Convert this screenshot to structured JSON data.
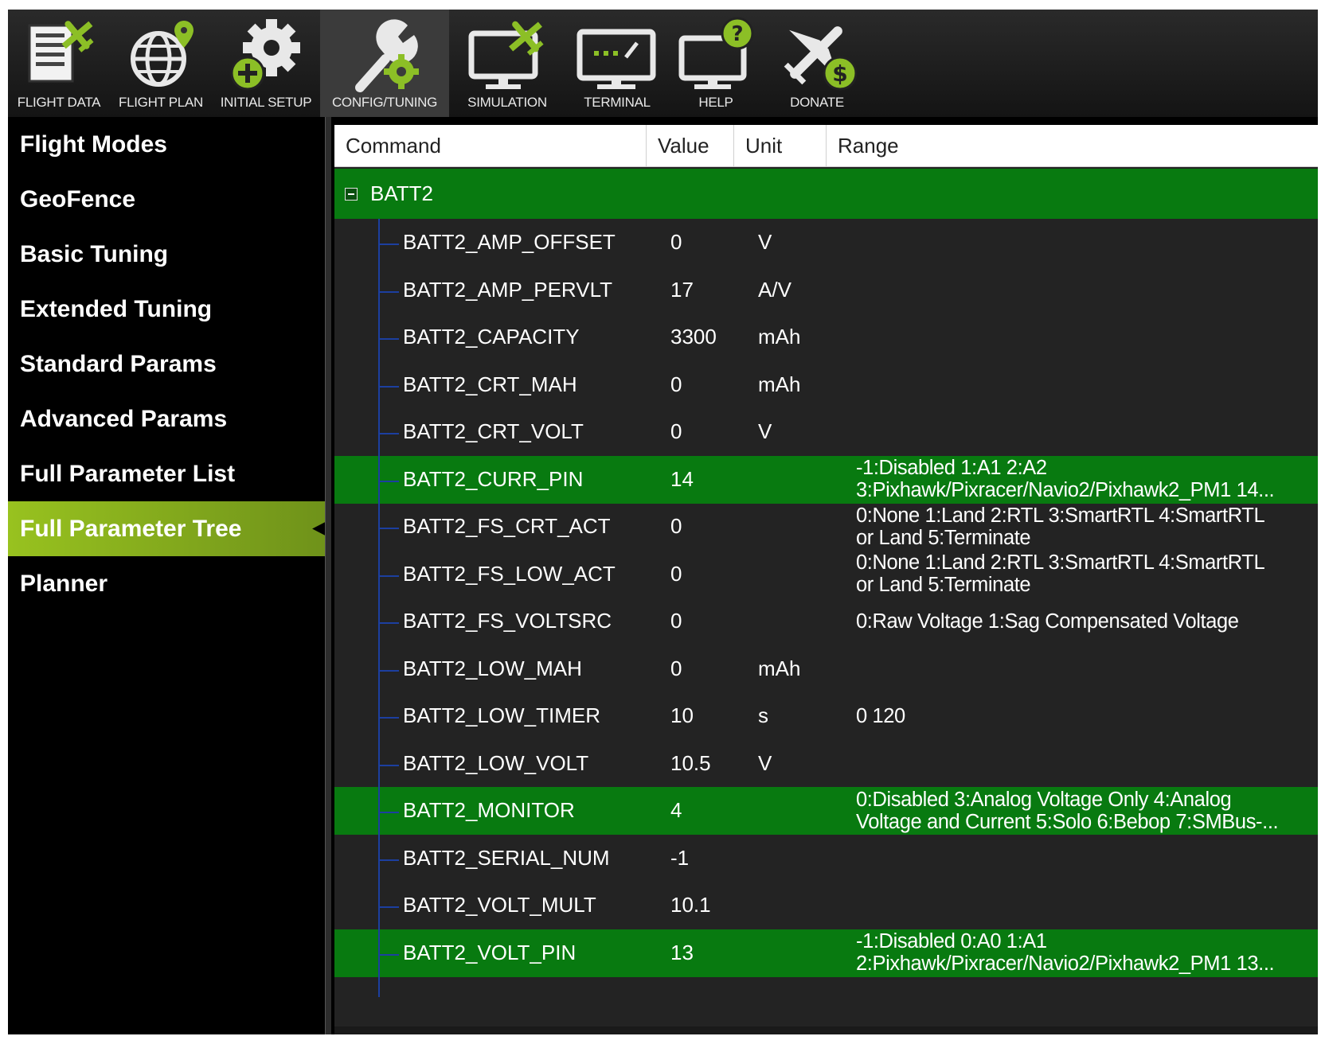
{
  "toolbar": {
    "items": [
      {
        "label": "FLIGHT DATA",
        "icon": "flight-data-icon"
      },
      {
        "label": "FLIGHT PLAN",
        "icon": "flight-plan-icon"
      },
      {
        "label": "INITIAL SETUP",
        "icon": "initial-setup-icon"
      },
      {
        "label": "CONFIG/TUNING",
        "icon": "config-tuning-icon",
        "active": true
      },
      {
        "label": "SIMULATION",
        "icon": "simulation-icon"
      },
      {
        "label": "TERMINAL",
        "icon": "terminal-icon"
      },
      {
        "label": "HELP",
        "icon": "help-icon"
      },
      {
        "label": "DONATE",
        "icon": "donate-icon"
      }
    ]
  },
  "sidebar": {
    "items": [
      {
        "label": "Flight Modes"
      },
      {
        "label": "GeoFence"
      },
      {
        "label": "Basic Tuning"
      },
      {
        "label": "Extended Tuning"
      },
      {
        "label": "Standard Params"
      },
      {
        "label": "Advanced Params"
      },
      {
        "label": "Full Parameter List"
      },
      {
        "label": "Full Parameter Tree",
        "active": true
      },
      {
        "label": "Planner"
      }
    ]
  },
  "grid": {
    "columns": [
      "Command",
      "Value",
      "Unit",
      "Range"
    ],
    "group": "BATT2",
    "rows": [
      {
        "command": "BATT2_AMP_OFFSET",
        "value": "0",
        "unit": "V",
        "range": "",
        "highlight": false
      },
      {
        "command": "BATT2_AMP_PERVLT",
        "value": "17",
        "unit": "A/V",
        "range": "",
        "highlight": false
      },
      {
        "command": "BATT2_CAPACITY",
        "value": "3300",
        "unit": "mAh",
        "range": "",
        "highlight": false
      },
      {
        "command": "BATT2_CRT_MAH",
        "value": "0",
        "unit": "mAh",
        "range": "",
        "highlight": false
      },
      {
        "command": "BATT2_CRT_VOLT",
        "value": "0",
        "unit": "V",
        "range": "",
        "highlight": false
      },
      {
        "command": "BATT2_CURR_PIN",
        "value": "14",
        "unit": "",
        "range": "-1:Disabled  1:A1  2:A2\n3:Pixhawk/Pixracer/Navio2/Pixhawk2_PM1  14...",
        "highlight": true
      },
      {
        "command": "BATT2_FS_CRT_ACT",
        "value": "0",
        "unit": "",
        "range": "0:None 1:Land 2:RTL 3:SmartRTL 4:SmartRTL\nor Land 5:Terminate",
        "highlight": false
      },
      {
        "command": "BATT2_FS_LOW_ACT",
        "value": "0",
        "unit": "",
        "range": "0:None 1:Land 2:RTL 3:SmartRTL 4:SmartRTL\nor Land 5:Terminate",
        "highlight": false
      },
      {
        "command": "BATT2_FS_VOLTSRC",
        "value": "0",
        "unit": "",
        "range": "0:Raw Voltage  1:Sag Compensated Voltage",
        "highlight": false
      },
      {
        "command": "BATT2_LOW_MAH",
        "value": "0",
        "unit": "mAh",
        "range": "",
        "highlight": false
      },
      {
        "command": "BATT2_LOW_TIMER",
        "value": "10",
        "unit": "s",
        "range": "0 120",
        "highlight": false
      },
      {
        "command": "BATT2_LOW_VOLT",
        "value": "10.5",
        "unit": "V",
        "range": "",
        "highlight": false
      },
      {
        "command": "BATT2_MONITOR",
        "value": "4",
        "unit": "",
        "range": "0:Disabled 3:Analog Voltage Only 4:Analog\nVoltage  and  Current  5:Solo  6:Bebop  7:SMBus-...",
        "highlight": true
      },
      {
        "command": "BATT2_SERIAL_NUM",
        "value": "-1",
        "unit": "",
        "range": "",
        "highlight": false
      },
      {
        "command": "BATT2_VOLT_MULT",
        "value": "10.1",
        "unit": "",
        "range": "",
        "highlight": false
      },
      {
        "command": "BATT2_VOLT_PIN",
        "value": "13",
        "unit": "",
        "range": "-1:Disabled  0:A0  1:A1\n2:Pixhawk/Pixracer/Navio2/Pixhawk2_PM1  13...",
        "highlight": true
      }
    ]
  },
  "colors": {
    "highlight_row": "#087a10",
    "sidebar_active": "#98c21f",
    "grid_background": "#232323"
  }
}
